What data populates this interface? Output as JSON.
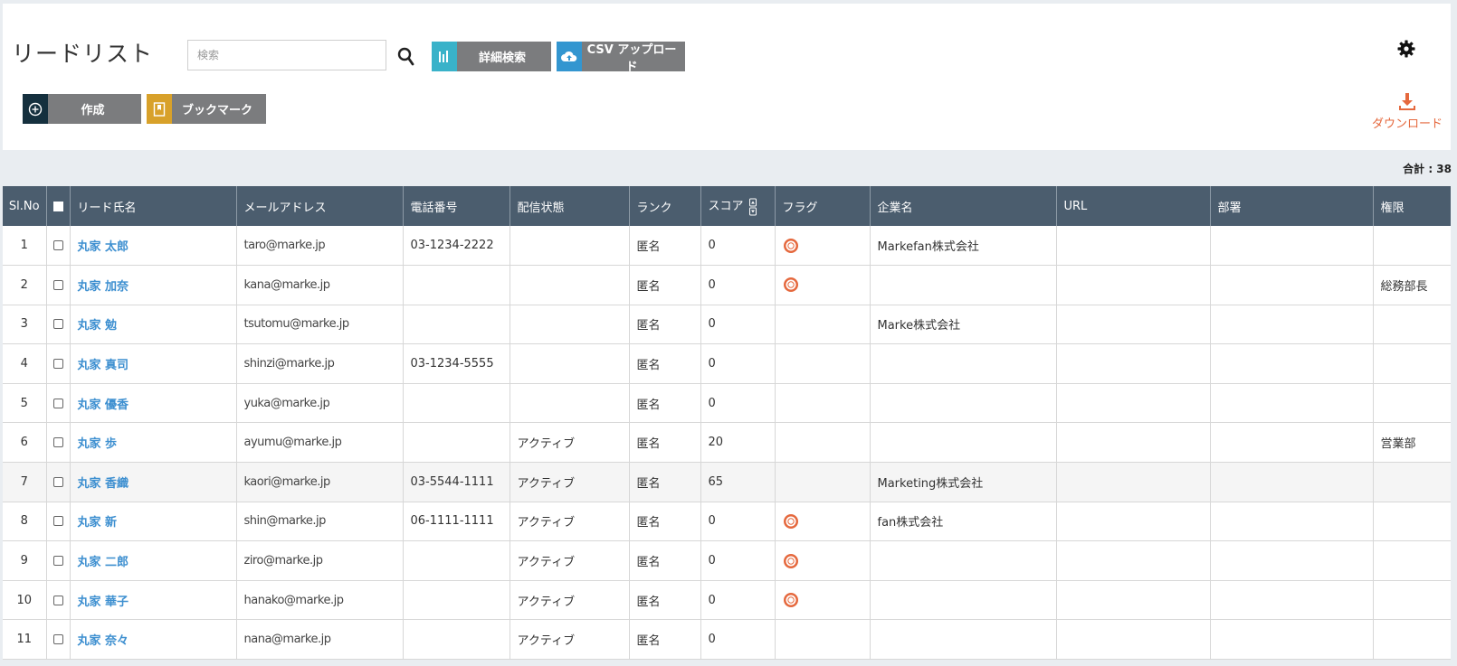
{
  "header": {
    "title": "リードリスト",
    "search_placeholder": "検索",
    "detail_search_label": "詳細検索",
    "csv_upload_label": "CSV アップロード",
    "create_label": "作成",
    "bookmark_label": "ブックマーク",
    "download_label": "ダウンロード"
  },
  "total_label": "合計 : 38",
  "table": {
    "columns": [
      "Sl.No",
      "",
      "リード氏名",
      "メールアドレス",
      "電話番号",
      "配信状態",
      "ランク",
      "スコア",
      "フラグ",
      "企業名",
      "URL",
      "部署",
      "権限"
    ],
    "rows": [
      {
        "no": "1",
        "name": "丸家 太郎",
        "email": "taro@marke.jp",
        "phone": "03-1234-2222",
        "status": "",
        "rank": "匿名",
        "score": "0",
        "flag": true,
        "company": "Markefan株式会社",
        "url": "",
        "dept": "",
        "role": ""
      },
      {
        "no": "2",
        "name": "丸家 加奈",
        "email": "kana@marke.jp",
        "phone": "",
        "status": "",
        "rank": "匿名",
        "score": "0",
        "flag": true,
        "company": "",
        "url": "",
        "dept": "",
        "role": "総務部長"
      },
      {
        "no": "3",
        "name": "丸家 勉",
        "email": "tsutomu@marke.jp",
        "phone": "",
        "status": "",
        "rank": "匿名",
        "score": "0",
        "flag": false,
        "company": "Marke株式会社",
        "url": "",
        "dept": "",
        "role": ""
      },
      {
        "no": "4",
        "name": "丸家 真司",
        "email": "shinzi@marke.jp",
        "phone": "03-1234-5555",
        "status": "",
        "rank": "匿名",
        "score": "0",
        "flag": false,
        "company": "",
        "url": "",
        "dept": "",
        "role": ""
      },
      {
        "no": "5",
        "name": "丸家 優香",
        "email": "yuka@marke.jp",
        "phone": "",
        "status": "",
        "rank": "匿名",
        "score": "0",
        "flag": false,
        "company": "",
        "url": "",
        "dept": "",
        "role": ""
      },
      {
        "no": "6",
        "name": "丸家 歩",
        "email": "ayumu@marke.jp",
        "phone": "",
        "status": "アクティブ",
        "rank": "匿名",
        "score": "20",
        "flag": false,
        "company": "",
        "url": "",
        "dept": "",
        "role": "営業部"
      },
      {
        "no": "7",
        "name": "丸家 香織",
        "email": "kaori@marke.jp",
        "phone": "03-5544-1111",
        "status": "アクティブ",
        "rank": "匿名",
        "score": "65",
        "flag": false,
        "company": "Marketing株式会社",
        "url": "",
        "dept": "",
        "role": ""
      },
      {
        "no": "8",
        "name": "丸家 新",
        "email": "shin@marke.jp",
        "phone": "06-1111-1111",
        "status": "アクティブ",
        "rank": "匿名",
        "score": "0",
        "flag": true,
        "company": "fan株式会社",
        "url": "",
        "dept": "",
        "role": ""
      },
      {
        "no": "9",
        "name": "丸家 二郎",
        "email": "ziro@marke.jp",
        "phone": "",
        "status": "アクティブ",
        "rank": "匿名",
        "score": "0",
        "flag": true,
        "company": "",
        "url": "",
        "dept": "",
        "role": ""
      },
      {
        "no": "10",
        "name": "丸家 華子",
        "email": "hanako@marke.jp",
        "phone": "",
        "status": "アクティブ",
        "rank": "匿名",
        "score": "0",
        "flag": true,
        "company": "",
        "url": "",
        "dept": "",
        "role": ""
      },
      {
        "no": "11",
        "name": "丸家 奈々",
        "email": "nana@marke.jp",
        "phone": "",
        "status": "アクティブ",
        "rank": "匿名",
        "score": "0",
        "flag": false,
        "company": "",
        "url": "",
        "dept": "",
        "role": ""
      }
    ]
  },
  "colors": {
    "header_bg": "#4b5d6e",
    "link": "#3d8fd0",
    "download": "#e5683d",
    "flag": "#e5683d"
  }
}
